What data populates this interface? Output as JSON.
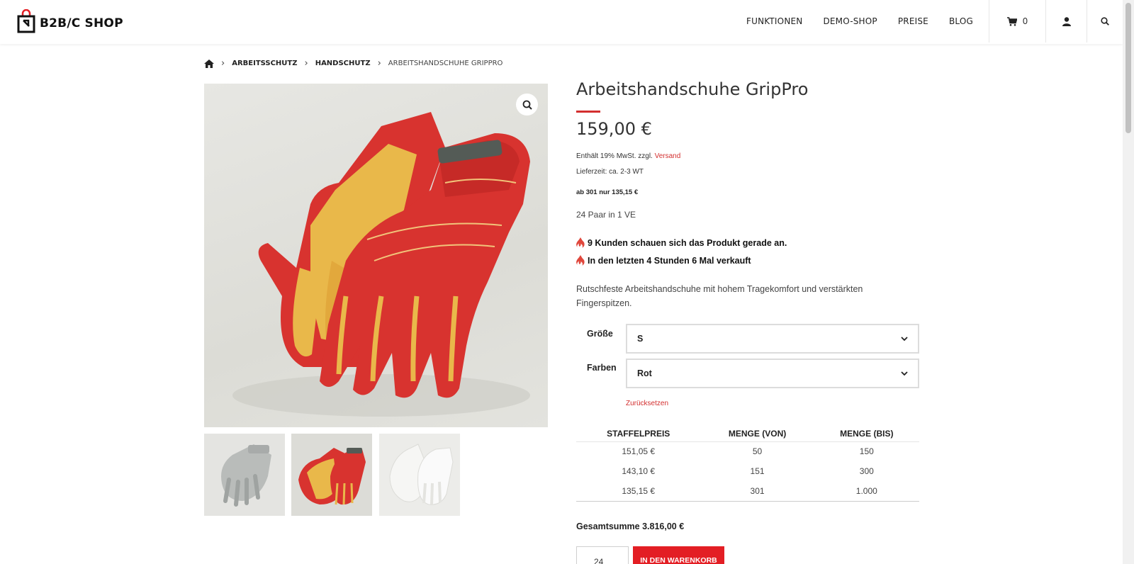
{
  "header": {
    "logo_text": "B2B/C SHOP",
    "nav": [
      "FUNKTIONEN",
      "DEMO-SHOP",
      "PREISE",
      "BLOG"
    ],
    "cart_count": "0"
  },
  "breadcrumb": {
    "items": [
      "ARBEITSSCHUTZ",
      "HANDSCHUTZ"
    ],
    "current": "ARBEITSHANDSCHUHE GRIPPRO"
  },
  "product": {
    "title": "Arbeitshandschuhe GripPro",
    "price": "159,00 €",
    "tax_text": "Enthält 19% MwSt.  zzgl.",
    "shipping_link": "Versand",
    "delivery": "Lieferzeit: ca. 2-3 WT",
    "bulk_note": "ab 301 nur 135,15 €",
    "packaging": "24 Paar in 1 VE",
    "promo_viewers": "9 Kunden schauen sich das Produkt gerade an.",
    "promo_sold": "In den letzten 4 Stunden 6 Mal verkauft",
    "description": "Rutschfeste Arbeitshandschuhe mit hohem Tragekomfort und verstärkten Fingerspitzen."
  },
  "variations": {
    "size_label": "Größe",
    "size_value": "S",
    "color_label": "Farben",
    "color_value": "Rot",
    "reset": "Zurücksetzen"
  },
  "tier_table": {
    "headers": [
      "STAFFELPREIS",
      "MENGE (VON)",
      "MENGE (BIS)"
    ],
    "rows": [
      [
        "151,05 €",
        "50",
        "150"
      ],
      [
        "143,10 €",
        "151",
        "300"
      ],
      [
        "135,15 €",
        "301",
        "1.000"
      ]
    ]
  },
  "purchase": {
    "total": "Gesamtsumme 3.816,00 €",
    "quantity": "24",
    "add_to_cart": "IN DEN WARENKORB"
  },
  "colors": {
    "accent": "#e31e24",
    "link_red": "#d32f2f",
    "glove_red": "#d8332f",
    "glove_yellow": "#e9b84a"
  },
  "icons": [
    "home-icon",
    "cart-icon",
    "user-icon",
    "search-icon",
    "zoom-icon",
    "fire-icon",
    "chevron-down-icon"
  ]
}
